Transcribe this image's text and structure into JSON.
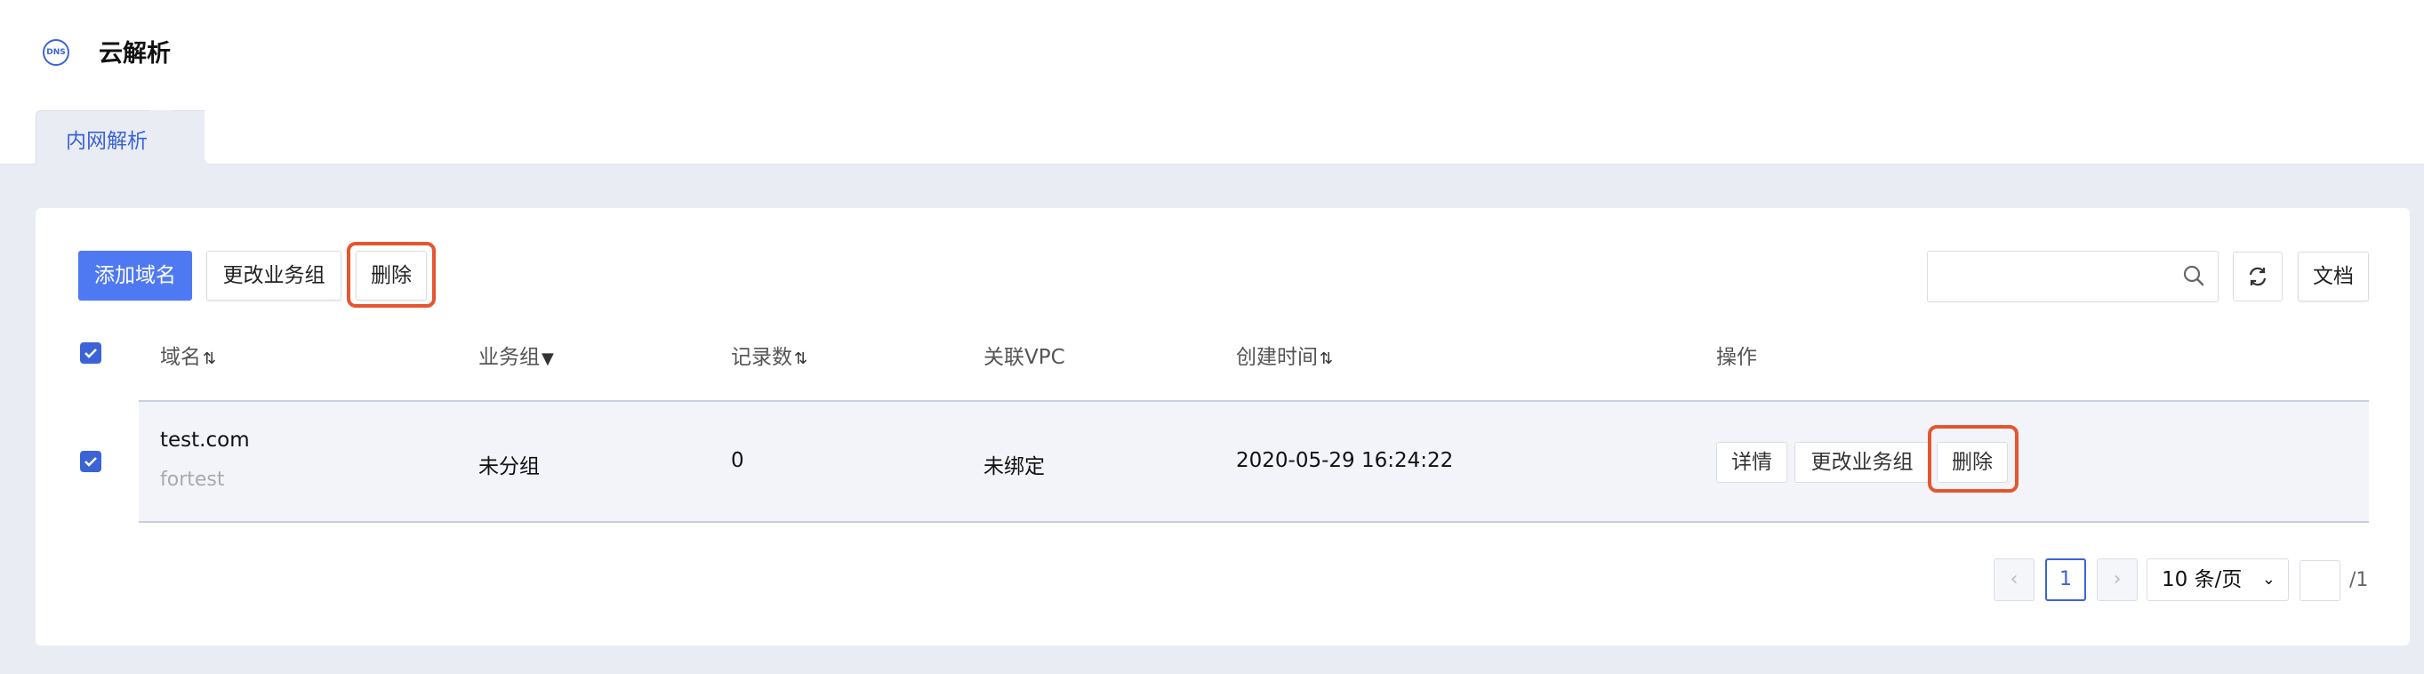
{
  "app": {
    "logo_text": "DNS",
    "title": "云解析"
  },
  "tabs": [
    {
      "label": "内网解析",
      "active": true
    }
  ],
  "toolbar": {
    "add_label": "添加域名",
    "change_group_label": "更改业务组",
    "delete_label": "删除",
    "search_placeholder": "",
    "docs_label": "文档"
  },
  "table": {
    "columns": [
      {
        "label": "域名",
        "icon": "sort-icon"
      },
      {
        "label": "业务组",
        "icon": "filter-icon"
      },
      {
        "label": "记录数",
        "icon": "sort-icon"
      },
      {
        "label": "关联VPC",
        "icon": ""
      },
      {
        "label": "创建时间",
        "icon": "sort-icon"
      },
      {
        "label": "操作",
        "icon": ""
      }
    ],
    "select_all_checked": true,
    "rows": [
      {
        "checked": true,
        "domain": "test.com",
        "remark": "fortest",
        "group": "未分组",
        "record_count": "0",
        "vpc": "未绑定",
        "created": "2020-05-29 16:24:22",
        "actions": {
          "detail": "详情",
          "change_group": "更改业务组",
          "delete": "删除"
        }
      }
    ]
  },
  "pagination": {
    "current_page": "1",
    "page_size": "10 条/页",
    "total_pages": "/1"
  },
  "colors": {
    "primary": "#4f79f2",
    "highlight": "#e5562f",
    "accent": "#3b63d6"
  }
}
